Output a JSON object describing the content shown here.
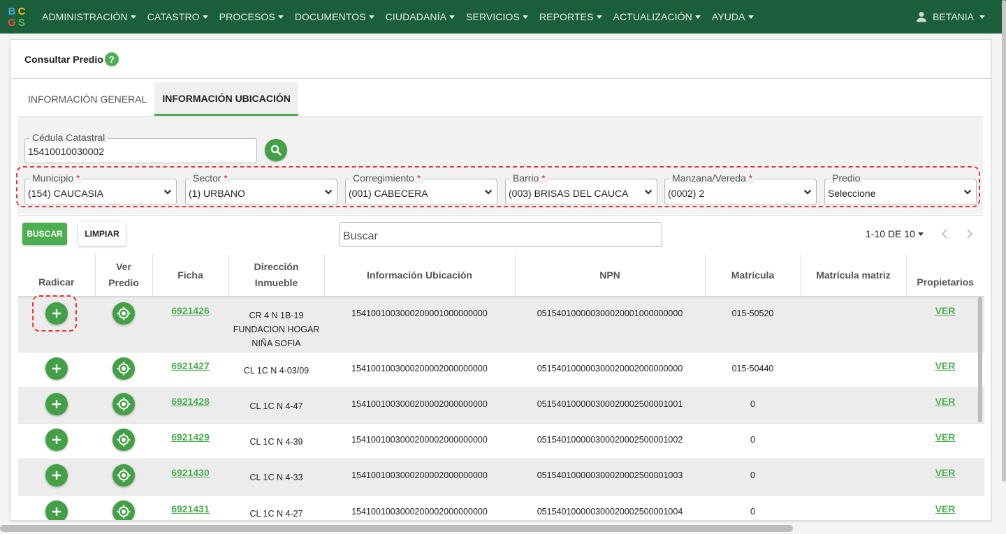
{
  "logo": {
    "letters": [
      "B",
      "C",
      "G",
      "S"
    ],
    "colors": [
      "#3da9e0",
      "#f4c20d",
      "#e94e3c",
      "#5bb85c"
    ]
  },
  "nav": {
    "items": [
      {
        "label": "ADMINISTRACIÓN"
      },
      {
        "label": "CATASTRO"
      },
      {
        "label": "PROCESOS"
      },
      {
        "label": "DOCUMENTOS"
      },
      {
        "label": "CIUDADANÍA"
      },
      {
        "label": "SERVICIOS"
      },
      {
        "label": "REPORTES"
      },
      {
        "label": "ACTUALIZACIÓN"
      },
      {
        "label": "AYUDA"
      }
    ],
    "user": "BETANIA"
  },
  "page": {
    "title": "Consultar Predio",
    "help_icon": "?"
  },
  "tabs": [
    {
      "label": "INFORMACIÓN GENERAL",
      "active": false
    },
    {
      "label": "INFORMACIÓN UBICACIÓN",
      "active": true
    }
  ],
  "form": {
    "cedula": {
      "label": "Cédula Catastral",
      "value": "15410010030002"
    },
    "selects": [
      {
        "label": "Municipio",
        "required": "*",
        "value": "(154) CAUCASIA"
      },
      {
        "label": "Sector",
        "required": "*",
        "value": "(1) URBANO"
      },
      {
        "label": "Corregimiento",
        "required": "*",
        "value": "(001) CABECERA"
      },
      {
        "label": "Barrio",
        "required": "*",
        "value": "(003) BRISAS DEL CAUCA"
      },
      {
        "label": "Manzana/Vereda",
        "required": "*",
        "value": "(0002) 2"
      },
      {
        "label": "Predio",
        "required": "",
        "value": "Seleccione"
      }
    ]
  },
  "toolbar": {
    "buscar_label": "BUSCAR",
    "limpiar_label": "LIMPIAR",
    "search_placeholder": "Buscar",
    "pager_label": "1-10 DE 10"
  },
  "table": {
    "headers": {
      "radicar": "Radicar",
      "ver_predio_1": "Ver",
      "ver_predio_2": "Predio",
      "ficha": "Ficha",
      "direccion_1": "Dirección",
      "direccion_2": "Inmueble",
      "info_ubicacion": "Información Ubicación",
      "npn": "NPN",
      "matricula": "Matrícula",
      "matricula_matriz": "Matrícula matriz",
      "propietarios": "Propietarios"
    },
    "rows": [
      {
        "ficha": "6921426",
        "direccion": [
          "CR 4 N 1B-19",
          "FUNDACION HOGAR",
          "NIÑA SOFIA"
        ],
        "info": "1541001003000200001000000000",
        "npn": "051540100000300020001000000000",
        "matricula": "015-50520",
        "matriz": "",
        "propietarios": "VER"
      },
      {
        "ficha": "6921427",
        "direccion": [
          "CL 1C N 4-03/09"
        ],
        "info": "1541001003000200002000000000",
        "npn": "051540100000300020002000000000",
        "matricula": "015-50440",
        "matriz": "",
        "propietarios": "VER"
      },
      {
        "ficha": "6921428",
        "direccion": [
          "CL 1C N 4-47"
        ],
        "info": "1541001003000200002000000000",
        "npn": "051540100000300020002500001001",
        "matricula": "0",
        "matriz": "",
        "propietarios": "VER"
      },
      {
        "ficha": "6921429",
        "direccion": [
          "CL 1C N 4-39"
        ],
        "info": "1541001003000200002000000000",
        "npn": "051540100000300020002500001002",
        "matricula": "0",
        "matriz": "",
        "propietarios": "VER"
      },
      {
        "ficha": "6921430",
        "direccion": [
          "CL 1C N 4-33"
        ],
        "info": "1541001003000200002000000000",
        "npn": "051540100000300020002500001003",
        "matricula": "0",
        "matriz": "",
        "propietarios": "VER"
      },
      {
        "ficha": "6921431",
        "direccion": [
          "CL 1C N 4-27"
        ],
        "info": "1541001003000200002000000000",
        "npn": "051540100000300020002500001004",
        "matricula": "0",
        "matriz": "",
        "propietarios": "VER"
      }
    ]
  }
}
